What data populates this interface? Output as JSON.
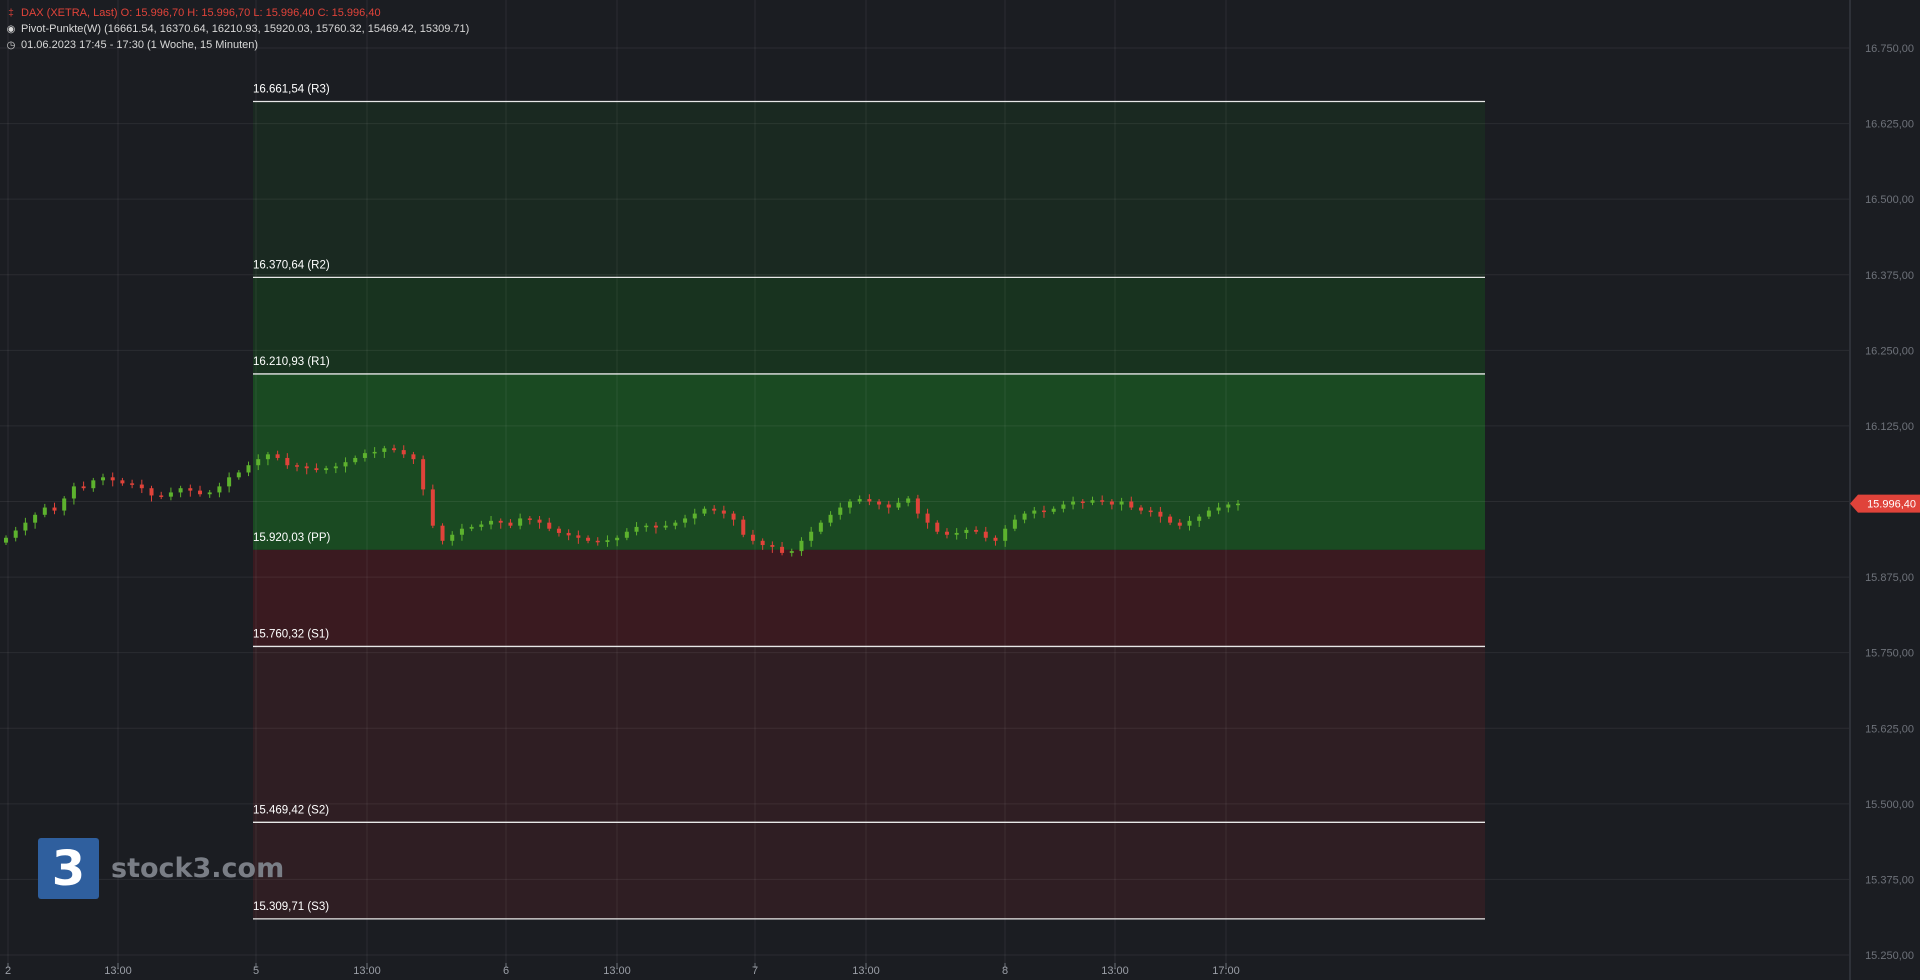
{
  "header": {
    "symbol_line": "DAX (XETRA, Last)  O: 15.996,70  H: 15.996,70  L: 15.996,40  C: 15.996,40",
    "indicator_line": "Pivot-Punkte(W)  (16661.54,  16370.64,  16210.93,  15920.03,  15760.32,  15469.42,  15309.71)",
    "period_line": "01.06.2023 17:45 - 17:30   (1 Woche, 15 Minuten)",
    "icons": [
      "candlestick-icon",
      "indicator-icon",
      "clock-icon"
    ]
  },
  "colors": {
    "up": "#5db22e",
    "down": "#e0433a",
    "resistance_zone": "#1a4a22",
    "support_zone": "#3a1a20",
    "last_price_badge": "#e0433a"
  },
  "logo": {
    "mark": "3",
    "text": "stock3.com"
  },
  "chart_data": {
    "type": "candlestick",
    "last_price": 15996.4,
    "last_price_label": "15.996,40",
    "ylim": [
      15225,
      16780
    ],
    "y_ticks": [
      {
        "value": 16750,
        "label": "16.750,00"
      },
      {
        "value": 16625,
        "label": "16.625,00"
      },
      {
        "value": 16500,
        "label": "16.500,00"
      },
      {
        "value": 16375,
        "label": "16.375,00"
      },
      {
        "value": 16250,
        "label": "16.250,00"
      },
      {
        "value": 16125,
        "label": "16.125,00"
      },
      {
        "value": 16000,
        "label": "16.000,00"
      },
      {
        "value": 15875,
        "label": "15.875,00"
      },
      {
        "value": 15750,
        "label": "15.750,00"
      },
      {
        "value": 15625,
        "label": "15.625,00"
      },
      {
        "value": 15500,
        "label": "15.500,00"
      },
      {
        "value": 15375,
        "label": "15.375,00"
      },
      {
        "value": 15250,
        "label": "15.250,00"
      }
    ],
    "x_ticks": [
      "2",
      "13:00",
      "5",
      "13:00",
      "6",
      "13:00",
      "7",
      "13:00",
      "8",
      "13:00",
      "17:00"
    ],
    "pivots": [
      {
        "name": "R3",
        "value": 16661.54,
        "label": "16.661,54 (R3)"
      },
      {
        "name": "R2",
        "value": 16370.64,
        "label": "16.370,64 (R2)"
      },
      {
        "name": "R1",
        "value": 16210.93,
        "label": "16.210,93 (R1)"
      },
      {
        "name": "PP",
        "value": 15920.03,
        "label": "15.920,03 (PP)"
      },
      {
        "name": "S1",
        "value": 15760.32,
        "label": "15.760,32 (S1)"
      },
      {
        "name": "S2",
        "value": 15469.42,
        "label": "15.469,42 (S2)"
      },
      {
        "name": "S3",
        "value": 15309.71,
        "label": "15.309,71 (S3)"
      }
    ],
    "close_series": [
      15940,
      15952,
      15965,
      15978,
      15990,
      15985,
      16005,
      16025,
      16022,
      16035,
      16040,
      16035,
      16030,
      16028,
      16022,
      16010,
      16008,
      16015,
      16022,
      16018,
      16012,
      16015,
      16025,
      16040,
      16048,
      16060,
      16070,
      16078,
      16072,
      16060,
      16058,
      16055,
      16052,
      16055,
      16058,
      16065,
      16072,
      16080,
      16082,
      16088,
      16085,
      16078,
      16070,
      16020,
      15960,
      15935,
      15945,
      15955,
      15958,
      15962,
      15968,
      15965,
      15960,
      15972,
      15970,
      15965,
      15955,
      15948,
      15944,
      15940,
      15935,
      15933,
      15936,
      15940,
      15950,
      15958,
      15960,
      15957,
      15960,
      15965,
      15972,
      15980,
      15988,
      15985,
      15980,
      15970,
      15945,
      15935,
      15928,
      15925,
      15915,
      15918,
      15935,
      15950,
      15965,
      15978,
      15990,
      16000,
      16004,
      16000,
      15995,
      15990,
      15998,
      16005,
      15980,
      15965,
      15950,
      15945,
      15948,
      15953,
      15950,
      15940,
      15935,
      15955,
      15970,
      15980,
      15985,
      15983,
      15988,
      15995,
      16000,
      15998,
      16002,
      16000,
      15995,
      16000,
      15990,
      15985,
      15983,
      15975,
      15965,
      15960,
      15968,
      15975,
      15985,
      15990,
      15995,
      15996.4
    ]
  }
}
